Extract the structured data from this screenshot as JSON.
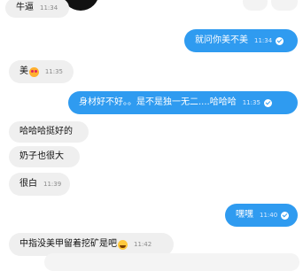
{
  "messages": [
    {
      "id": "m0",
      "dir": "in",
      "text": "牛逼",
      "time": "11:34"
    },
    {
      "id": "m1",
      "dir": "out",
      "text": "就问你美不美",
      "time": "11:34",
      "read": true
    },
    {
      "id": "m2",
      "dir": "in",
      "text": "美",
      "emoji": "heart-eyes-emoji",
      "time": "11:35"
    },
    {
      "id": "m3",
      "dir": "out",
      "text": "身材好不好。。是不是独一无二....哈哈哈",
      "time": "11:35",
      "read": true
    },
    {
      "id": "m4",
      "dir": "in",
      "text": "哈哈哈挺好的"
    },
    {
      "id": "m5",
      "dir": "in",
      "text": "奶子也很大"
    },
    {
      "id": "m6",
      "dir": "in",
      "text": "很白",
      "time": "11:39"
    },
    {
      "id": "m7",
      "dir": "out",
      "text": "嘿嘿",
      "time": "11:40",
      "read": true
    },
    {
      "id": "m8",
      "dir": "in",
      "text": "中指没美甲留着挖矿是吧",
      "emoji": "laughing-tears-emoji",
      "time": "11:42"
    }
  ],
  "colors": {
    "outgoing": "#2f9bf0",
    "incoming": "#efefef"
  }
}
